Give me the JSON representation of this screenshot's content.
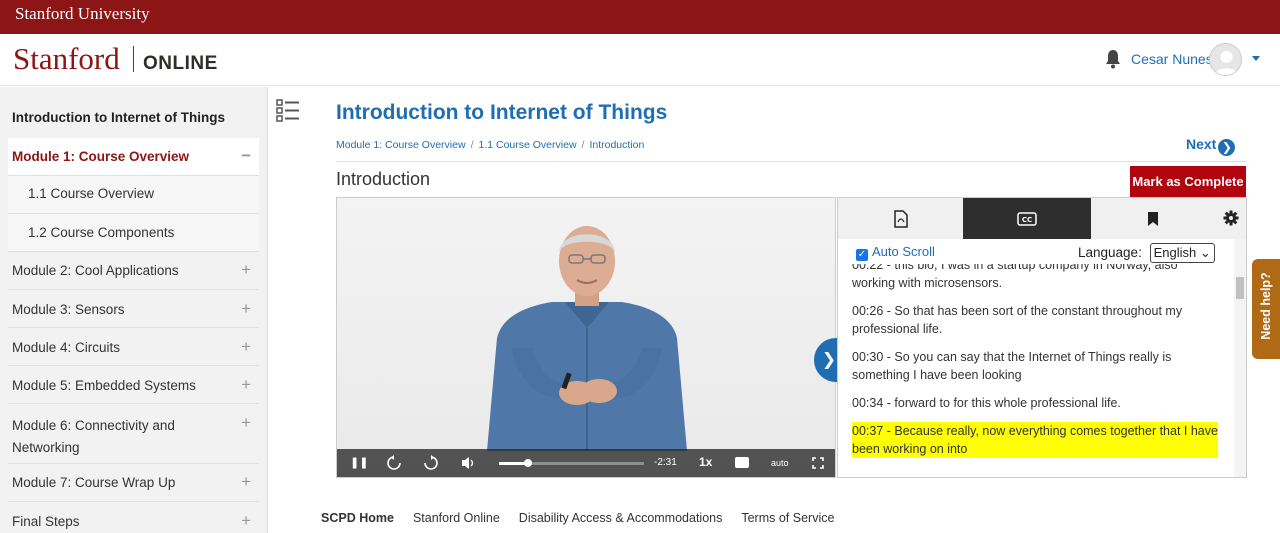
{
  "university_bar": {
    "label": "Stanford University"
  },
  "header": {
    "logo_main": "Stanford",
    "logo_sub": "ONLINE",
    "user_name": "Cesar Nunes"
  },
  "sidebar": {
    "title": "Introduction to Internet of Things",
    "items": [
      {
        "label": "Module 1: Course Overview",
        "toggle": "−"
      },
      {
        "label": "1.1 Course Overview"
      },
      {
        "label": "1.2 Course Components"
      },
      {
        "label": "Module 2: Cool Applications",
        "toggle": "+"
      },
      {
        "label": "Module 3: Sensors",
        "toggle": "+"
      },
      {
        "label": "Module 4: Circuits",
        "toggle": "+"
      },
      {
        "label": "Module 5: Embedded Systems",
        "toggle": "+"
      },
      {
        "label": "Module 6: Connectivity and Networking",
        "toggle": "+"
      },
      {
        "label": "Module 7: Course Wrap Up",
        "toggle": "+"
      },
      {
        "label": "Final Steps",
        "toggle": "+"
      }
    ]
  },
  "main": {
    "title": "Introduction to Internet of Things",
    "breadcrumb": [
      "Module 1: Course Overview",
      "1.1 Course Overview",
      "Introduction"
    ],
    "breadcrumb_sep": "/",
    "next_label": "Next",
    "section_title": "Introduction",
    "complete_label": "Mark as Complete"
  },
  "video": {
    "time_remaining": "-2:31",
    "speed": "1x",
    "quality": "auto",
    "progress_fraction": 0.2
  },
  "transcript_panel": {
    "autoscroll_label": "Auto Scroll",
    "autoscroll_checked": true,
    "language_label": "Language:",
    "language_value": "English",
    "lines": [
      "00:22 - this bio, I was in a startup company in Norway, also working with microsensors.",
      "00:26 - So that has been sort of the constant throughout my professional life.",
      "00:30 - So you can say that the Internet of Things really is something I have been looking",
      "00:34 - forward to for this whole professional life.",
      "00:37 - Because really, now everything comes together that I have been working on into"
    ],
    "highlight_index": 4
  },
  "need_help": {
    "label": "Need help?"
  },
  "footer": {
    "links": [
      "SCPD Home",
      "Stanford Online",
      "Disability Access & Accommodations",
      "Terms of Service"
    ]
  },
  "colors": {
    "cardinal": "#8c1515",
    "link_blue": "#1f6eb4",
    "complete_red": "#b1040e",
    "help_orange": "#b06a15",
    "highlight": "#ffff00"
  }
}
